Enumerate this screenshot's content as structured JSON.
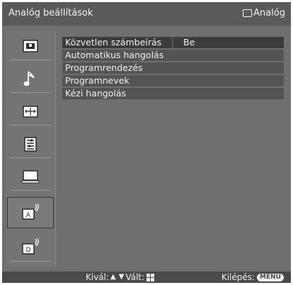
{
  "header": {
    "title": "Analóg beállítások",
    "source_label": "Analóg",
    "source_icon": "tv-screen-icon"
  },
  "sidebar": {
    "items": [
      {
        "name": "picture-icon"
      },
      {
        "name": "sound-note-icon"
      },
      {
        "name": "screen-settings-icon"
      },
      {
        "name": "setup-list-icon"
      },
      {
        "name": "pc-monitor-icon"
      },
      {
        "name": "analog-antenna-icon",
        "letter": "A",
        "active": true
      },
      {
        "name": "digital-antenna-icon",
        "letter": "D"
      }
    ]
  },
  "menu": {
    "items": [
      {
        "label": "Közvetlen számbeírás",
        "value": "Be",
        "selected": true
      },
      {
        "label": "Automatikus hangolás"
      },
      {
        "label": "Programrendezés"
      },
      {
        "label": "Programnevek"
      },
      {
        "label": "Kézi hangolás"
      }
    ]
  },
  "footer": {
    "select_text": "Kivál:",
    "switch_text": "Vált:",
    "exit_text": "Kilépés:",
    "menu_key": "MENU"
  },
  "colors": {
    "background": "#6f6f6f",
    "title_bar": "#5a5a5a",
    "row": "#545454",
    "row_selected": "#3c3c3c",
    "footer": "#4a4a4a",
    "text": "#f0f0f0"
  }
}
